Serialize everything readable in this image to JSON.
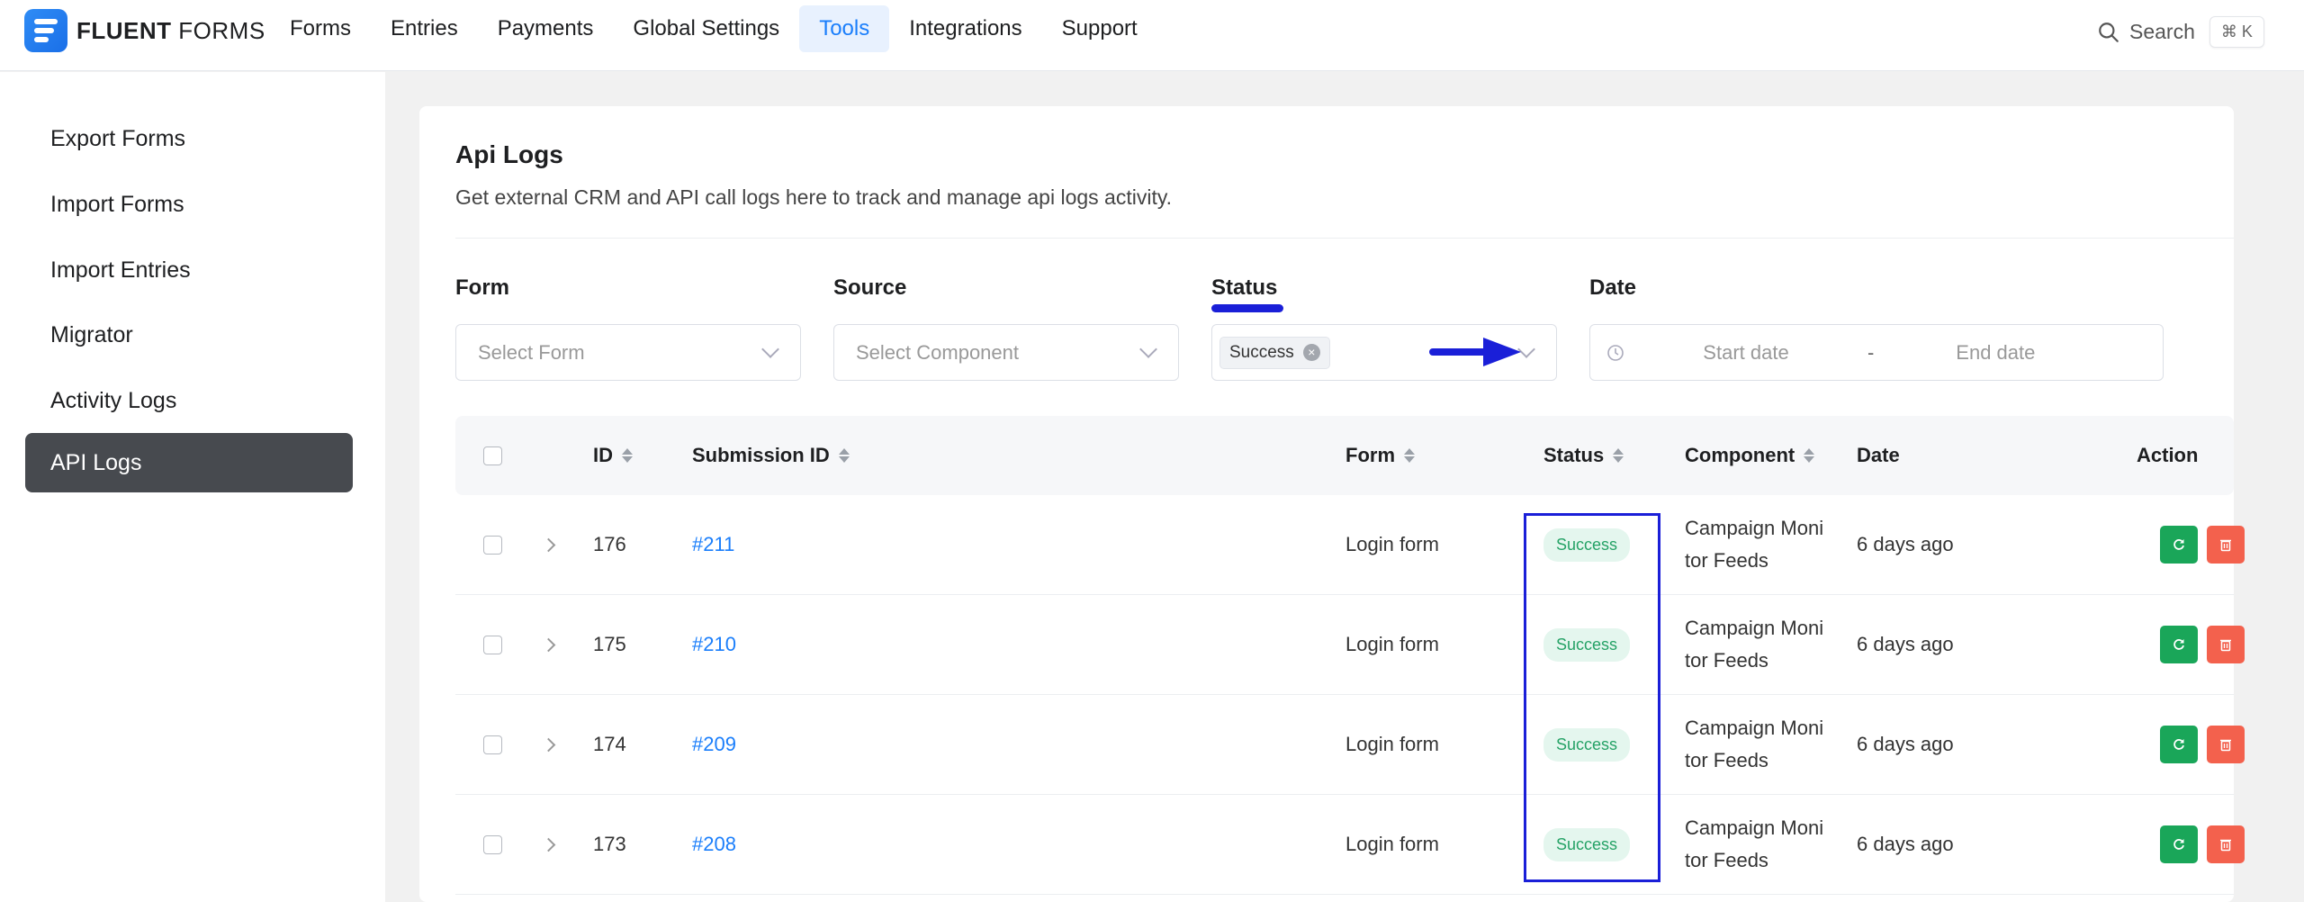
{
  "brand": {
    "name_bold": "FLUENT",
    "name_light": "FORMS"
  },
  "nav": {
    "items": [
      "Forms",
      "Entries",
      "Payments",
      "Global Settings",
      "Tools",
      "Integrations",
      "Support"
    ],
    "active": "Tools"
  },
  "search": {
    "label": "Search",
    "shortcut": "⌘ K"
  },
  "sidebar": {
    "items": [
      {
        "label": "Export Forms"
      },
      {
        "label": "Import Forms"
      },
      {
        "label": "Import Entries"
      },
      {
        "label": "Migrator"
      },
      {
        "label": "Activity Logs"
      },
      {
        "label": "API Logs",
        "active": true
      }
    ]
  },
  "page": {
    "title": "Api Logs",
    "subtitle": "Get external CRM and API call logs here to track and manage api logs activity."
  },
  "filters": {
    "form": {
      "label": "Form",
      "placeholder": "Select Form"
    },
    "source": {
      "label": "Source",
      "placeholder": "Select Component"
    },
    "status": {
      "label": "Status",
      "selected": "Success"
    },
    "date": {
      "label": "Date",
      "start_placeholder": "Start date",
      "separator": "-",
      "end_placeholder": "End date"
    }
  },
  "table": {
    "columns": {
      "id": "ID",
      "submission_id": "Submission ID",
      "form": "Form",
      "status": "Status",
      "component": "Component",
      "date": "Date",
      "action": "Action"
    },
    "rows": [
      {
        "id": "176",
        "submission": "#211",
        "form": "Login form",
        "status": "Success",
        "component_l1": "Campaign Moni",
        "component_l2": "tor Feeds",
        "date": "6 days ago"
      },
      {
        "id": "175",
        "submission": "#210",
        "form": "Login form",
        "status": "Success",
        "component_l1": "Campaign Moni",
        "component_l2": "tor Feeds",
        "date": "6 days ago"
      },
      {
        "id": "174",
        "submission": "#209",
        "form": "Login form",
        "status": "Success",
        "component_l1": "Campaign Moni",
        "component_l2": "tor Feeds",
        "date": "6 days ago"
      },
      {
        "id": "173",
        "submission": "#208",
        "form": "Login form",
        "status": "Success",
        "component_l1": "Campaign Moni",
        "component_l2": "tor Feeds",
        "date": "6 days ago"
      }
    ]
  },
  "colors": {
    "accent": "#1a7efb",
    "annotation": "#1a1fd8",
    "success_bg": "#e4f6ee",
    "success_text": "#25a266",
    "retry": "#1aa659",
    "delete": "#f3614d"
  }
}
